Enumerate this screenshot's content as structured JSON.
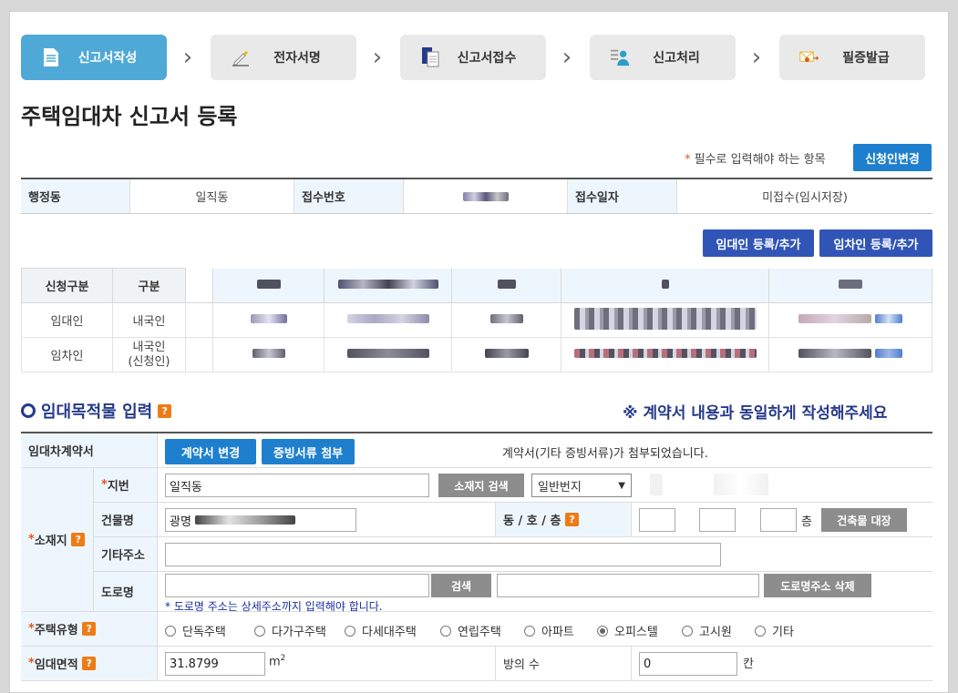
{
  "steps": [
    {
      "label": "신고서작성",
      "icon": "document-icon"
    },
    {
      "label": "전자서명",
      "icon": "signature-pen-icon"
    },
    {
      "label": "신고서접수",
      "icon": "documents-icon"
    },
    {
      "label": "신고처리",
      "icon": "user-process-icon"
    },
    {
      "label": "필증발급",
      "icon": "certificate-mail-icon"
    }
  ],
  "page_title": "주택임대차 신고서 등록",
  "required_note": {
    "star": "*",
    "text": " 필수로 입력해야 하는 항목"
  },
  "buttons": {
    "change_applicant": "신청인변경",
    "add_landlord": "임대인 등록/추가",
    "add_tenant": "임차인 등록/추가",
    "change_contract": "계약서 변경",
    "attach_evidence": "증빙서류 첨부",
    "search_location": "소재지 검색",
    "building_ledger": "건축물 대장",
    "search_road": "검색",
    "delete_road": "도로명주소 삭제"
  },
  "info": {
    "district_label": "행정동",
    "district_value": "일직동",
    "receipt_no_label": "접수번호",
    "receipt_date_label": "접수일자",
    "receipt_date_value": "미접수(임시저장)"
  },
  "party_table": {
    "headers": [
      "신청구분",
      "구분"
    ],
    "rows": [
      {
        "type": "임대인",
        "kind": "내국인"
      },
      {
        "type": "임차인",
        "kind": "내국인\n(신청인)"
      }
    ]
  },
  "section": {
    "title": "임대목적물 입력",
    "note": "※ 계약서 내용과 동일하게 작성해주세요",
    "qmark": "?"
  },
  "form": {
    "contract_label": "임대차계약서",
    "contract_status": "계약서(기타 증빙서류)가 첨부되었습니다.",
    "location_label": "소재지",
    "jibun_label": "지번",
    "jibun_value": "일직동",
    "jibun_select": "일반번지",
    "building_label": "건물명",
    "building_value": "광명",
    "dong_ho_floor_label": "동 / 호 / 층",
    "floor_unit": "층",
    "other_addr_label": "기타주소",
    "road_label": "도로명",
    "road_note": "* 도로명 주소는 상세주소까지 입력해야 합니다.",
    "house_type_label": "주택유형",
    "house_types": [
      "단독주택",
      "다가구주택",
      "다세대주택",
      "연립주택",
      "아파트",
      "오피스텔",
      "고시원",
      "기타"
    ],
    "house_type_selected": "오피스텔",
    "area_label": "임대면적",
    "area_value": "31.8799",
    "area_unit": "m",
    "area_unit_sup": "2",
    "rooms_label": "방의 수",
    "rooms_value": "0",
    "rooms_unit": "칸",
    "star": "*"
  },
  "colors": {
    "active_step": "#4fa9d6",
    "primary_button": "#1f7fcf",
    "navy_button": "#3155b6",
    "header_bg": "#eef6fd",
    "accent_text": "#263a8a",
    "required_star": "#e05a1a",
    "help_badge": "#ee7b16"
  }
}
